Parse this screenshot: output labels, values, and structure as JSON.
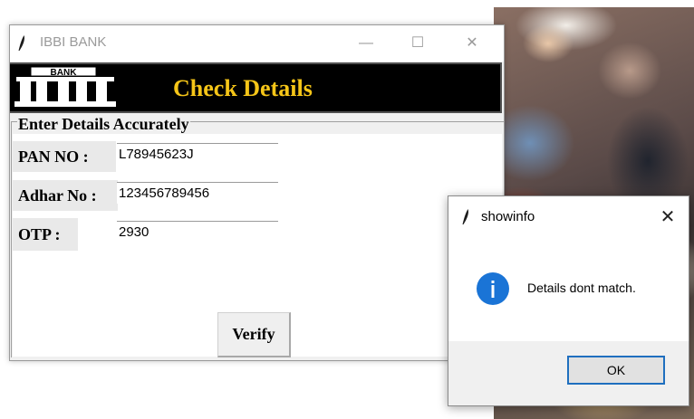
{
  "main_window": {
    "title": "IBBI BANK",
    "controls": {
      "minimize": "—",
      "maximize": "☐",
      "close": "✕"
    },
    "banner": {
      "logo_text": "BANK",
      "title": "Check Details"
    },
    "form": {
      "group_label": "Enter Details Accurately",
      "pan_label": "PAN NO :",
      "pan_value": "L78945623J",
      "adhar_label": "Adhar No :",
      "adhar_value": "123456789456",
      "otp_label": "OTP :",
      "otp_value": "2930",
      "verify_label": "Verify"
    },
    "colors": {
      "banner_bg": "#000000",
      "banner_title": "#f5c518"
    }
  },
  "dialog": {
    "title": "showinfo",
    "close": "✕",
    "message": "Details dont match.",
    "ok_label": "OK",
    "icon": "info-icon",
    "colors": {
      "icon": "#1a74d6",
      "ok_border": "#1f6fbf"
    }
  }
}
